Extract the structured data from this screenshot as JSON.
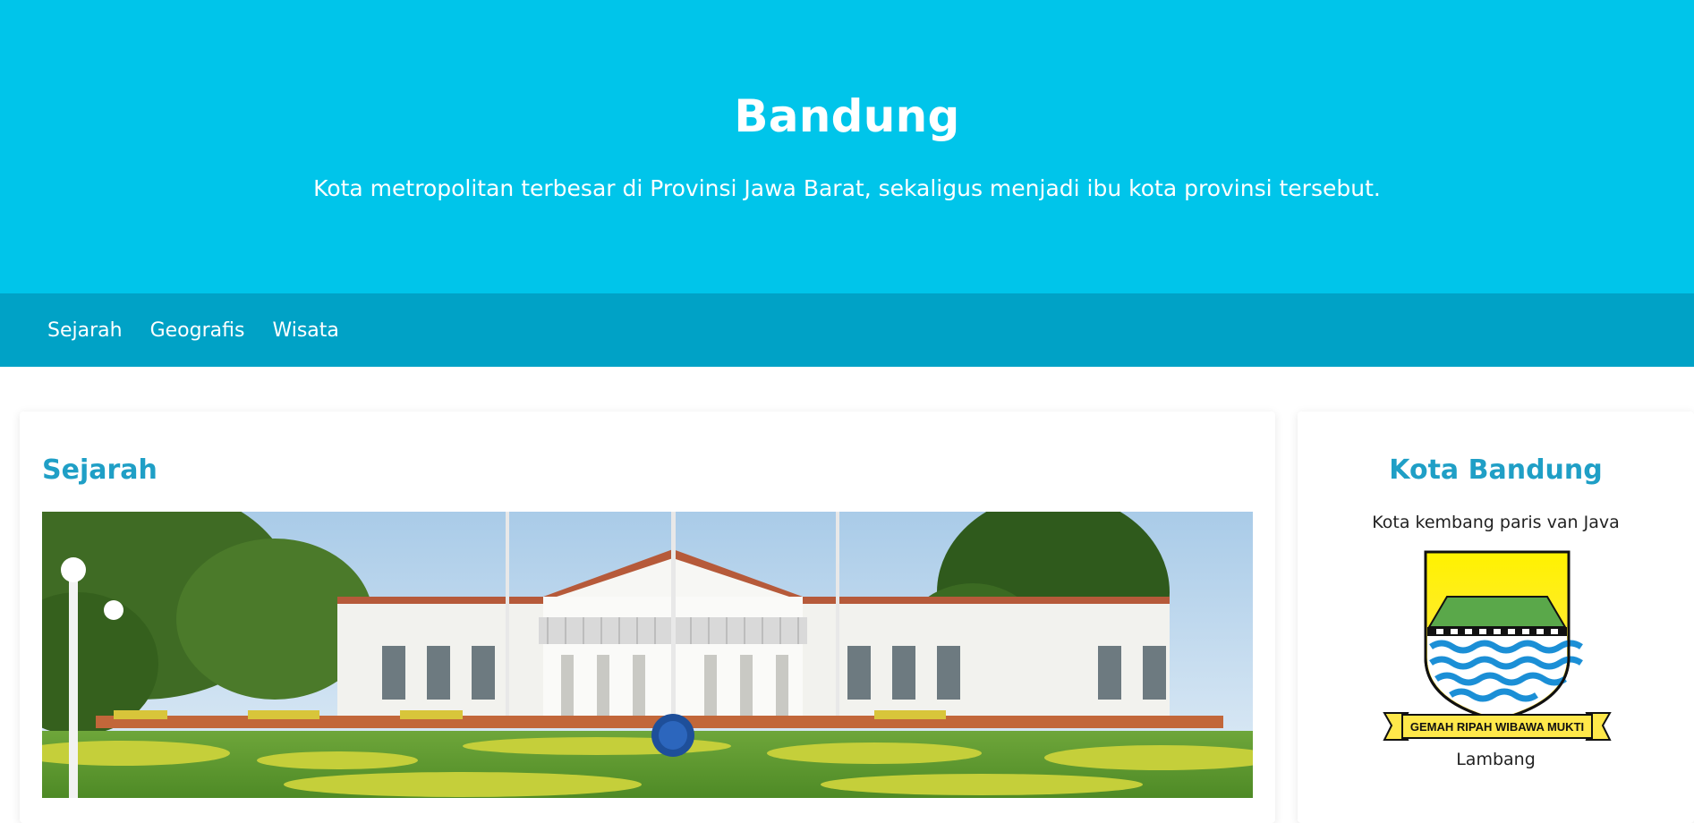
{
  "header": {
    "title": "Bandung",
    "subtitle": "Kota metropolitan terbesar di Provinsi Jawa Barat, sekaligus menjadi ibu kota provinsi tersebut."
  },
  "nav": {
    "items": [
      {
        "label": "Sejarah"
      },
      {
        "label": "Geografis"
      },
      {
        "label": "Wisata"
      }
    ]
  },
  "main": {
    "section_title": "Sejarah",
    "image_alt": "Gedung Sate building photo"
  },
  "sidebar": {
    "title": "Kota Bandung",
    "tagline": "Kota kembang paris van Java",
    "emblem_motto": "GEMAH RIPAH WIBAWA MUKTI",
    "emblem_caption": "Lambang"
  },
  "colors": {
    "hero_bg": "#00c5ea",
    "nav_bg": "#00a2c6",
    "accent_heading": "#1f9fc6"
  }
}
